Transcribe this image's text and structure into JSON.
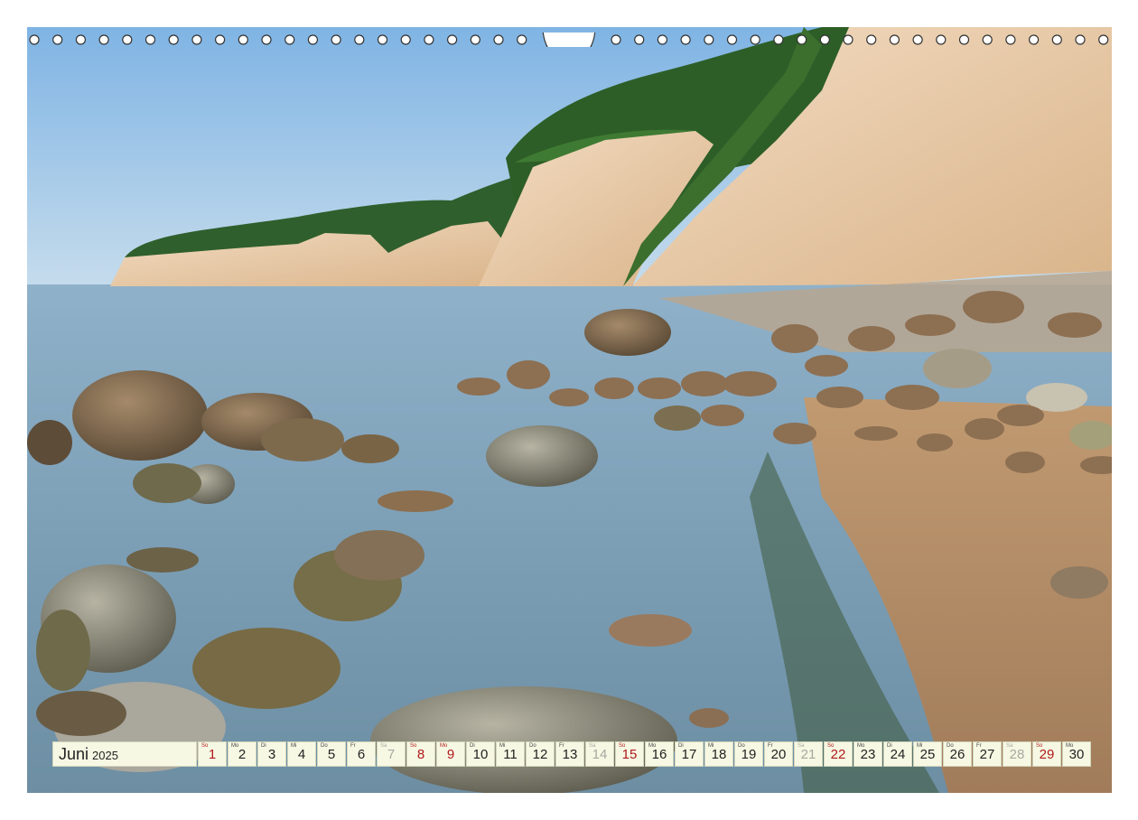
{
  "calendar": {
    "month": "Juni",
    "year": "2025",
    "days": [
      {
        "wd": "So",
        "num": "1",
        "type": "sun"
      },
      {
        "wd": "Mo",
        "num": "2",
        "type": "work"
      },
      {
        "wd": "Di",
        "num": "3",
        "type": "work"
      },
      {
        "wd": "Mi",
        "num": "4",
        "type": "work"
      },
      {
        "wd": "Do",
        "num": "5",
        "type": "work"
      },
      {
        "wd": "Fr",
        "num": "6",
        "type": "work"
      },
      {
        "wd": "Sa",
        "num": "7",
        "type": "sat"
      },
      {
        "wd": "So",
        "num": "8",
        "type": "sun"
      },
      {
        "wd": "Mo",
        "num": "9",
        "type": "sun"
      },
      {
        "wd": "Di",
        "num": "10",
        "type": "work"
      },
      {
        "wd": "Mi",
        "num": "11",
        "type": "work"
      },
      {
        "wd": "Do",
        "num": "12",
        "type": "work"
      },
      {
        "wd": "Fr",
        "num": "13",
        "type": "work"
      },
      {
        "wd": "Sa",
        "num": "14",
        "type": "sat"
      },
      {
        "wd": "So",
        "num": "15",
        "type": "sun"
      },
      {
        "wd": "Mo",
        "num": "16",
        "type": "work"
      },
      {
        "wd": "Di",
        "num": "17",
        "type": "work"
      },
      {
        "wd": "Mi",
        "num": "18",
        "type": "work"
      },
      {
        "wd": "Do",
        "num": "19",
        "type": "work"
      },
      {
        "wd": "Fr",
        "num": "20",
        "type": "work"
      },
      {
        "wd": "Sa",
        "num": "21",
        "type": "sat"
      },
      {
        "wd": "So",
        "num": "22",
        "type": "sun"
      },
      {
        "wd": "Mo",
        "num": "23",
        "type": "work"
      },
      {
        "wd": "Di",
        "num": "24",
        "type": "work"
      },
      {
        "wd": "Mi",
        "num": "25",
        "type": "work"
      },
      {
        "wd": "Do",
        "num": "26",
        "type": "work"
      },
      {
        "wd": "Fr",
        "num": "27",
        "type": "work"
      },
      {
        "wd": "Sa",
        "num": "28",
        "type": "sat"
      },
      {
        "wd": "So",
        "num": "29",
        "type": "sun"
      },
      {
        "wd": "Mo",
        "num": "30",
        "type": "work"
      }
    ],
    "colors": {
      "sunday": "#b0181b",
      "saturday": "#a8a8a0",
      "cell_bg": "#f6f8e3"
    }
  },
  "photo": {
    "subject": "chalk-cliffs-coast-icon"
  }
}
